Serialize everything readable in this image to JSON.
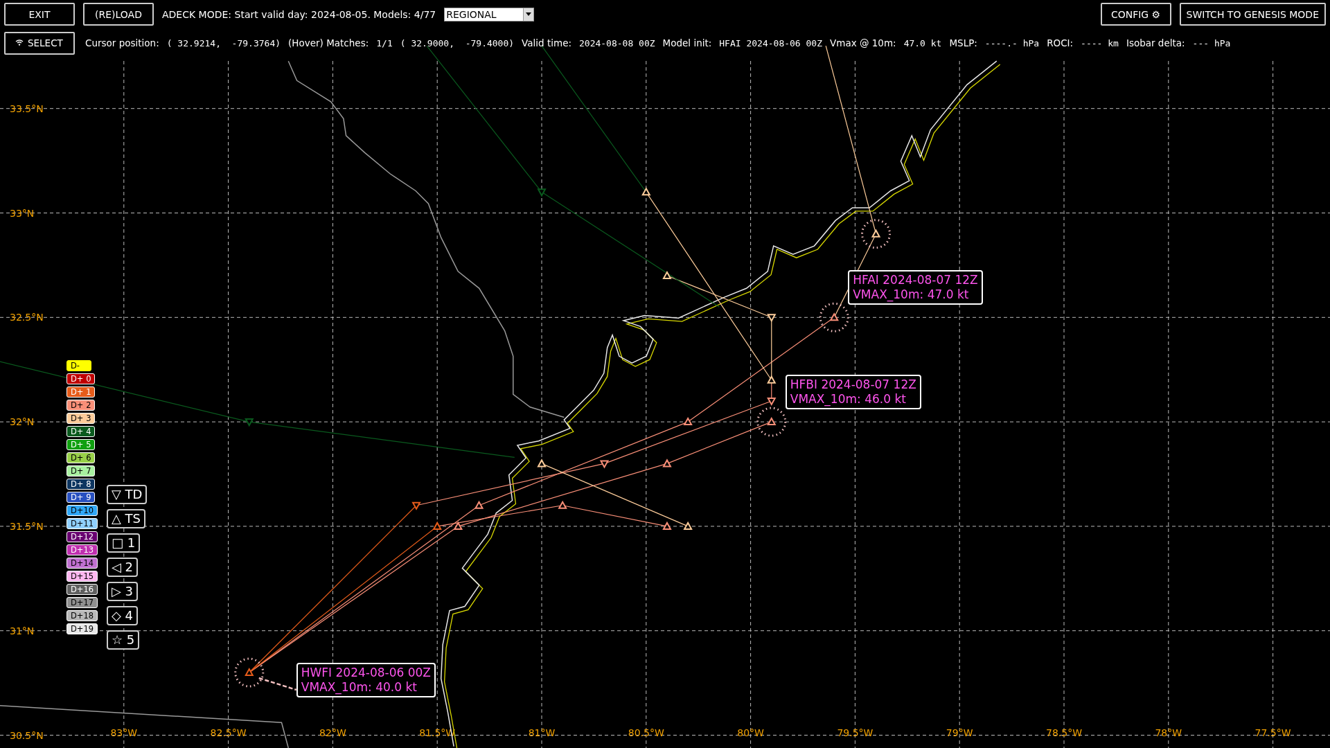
{
  "toolbar": {
    "left_buttons": [
      "EXIT",
      "(RE)LOAD"
    ],
    "mode_text": "ADECK MODE: Start valid day: 2024-08-05. Models: 4/77",
    "region_select": {
      "value": "REGIONAL"
    },
    "right_buttons": [
      "CONFIG ⚙",
      "SWITCH TO GENESIS MODE"
    ]
  },
  "status_bar": {
    "select_button": "SELECT",
    "fields": [
      {
        "label": "Cursor position:",
        "values": [
          "( 32.9214,  -79.3764)"
        ]
      },
      {
        "label": "(Hover) Matches:",
        "values": [
          "1/1",
          "( 32.9000,  -79.4000)"
        ]
      },
      {
        "label": "Valid time:",
        "values": [
          "2024-08-08 00Z"
        ]
      },
      {
        "label": "Model init:",
        "values": [
          "HFAI 2024-08-06 00Z"
        ]
      },
      {
        "label": "Vmax @ 10m:",
        "values": [
          "47.0 kt"
        ]
      },
      {
        "label": "MSLP:",
        "values": [
          "----.- hPa"
        ]
      },
      {
        "label": "ROCI:",
        "values": [
          "---- km"
        ]
      },
      {
        "label": "Isobar delta:",
        "values": [
          "--- hPa"
        ]
      }
    ]
  },
  "map": {
    "lat_labels": [
      "33.5°N",
      "33°N",
      "32.5°N",
      "32°N",
      "31.5°N",
      "31°N",
      "30.5°N"
    ],
    "lon_labels": [
      "83°W",
      "82.5°W",
      "82°W",
      "81.5°W",
      "81°W",
      "80.5°W",
      "80°W",
      "79.5°W",
      "79°W",
      "78.5°W",
      "78°W",
      "77.5°W"
    ],
    "hover_labels": [
      {
        "title": "HFAI 2024-08-07 12Z",
        "vmax": "VMAX_10m: 47.0 kt"
      },
      {
        "title": "HFBI 2024-08-07 12Z",
        "vmax": "VMAX_10m: 46.0 kt"
      },
      {
        "title": "HWFI 2024-08-06 00Z",
        "vmax": "VMAX_10m: 40.0 kt"
      }
    ]
  },
  "day_legend": [
    {
      "label": "D-",
      "color": "#ffff00"
    },
    {
      "label": "D+ 0",
      "color": "#c00000"
    },
    {
      "label": "D+ 1",
      "color": "#e65c1a"
    },
    {
      "label": "D+ 2",
      "color": "#fa8f78"
    },
    {
      "label": "D+ 3",
      "color": "#fdcc9a"
    },
    {
      "label": "D+ 4",
      "color": "#0a5a1e"
    },
    {
      "label": "D+ 5",
      "color": "#10a010"
    },
    {
      "label": "D+ 6",
      "color": "#98d048"
    },
    {
      "label": "D+ 7",
      "color": "#a8f0a0"
    },
    {
      "label": "D+ 8",
      "color": "#0d3560"
    },
    {
      "label": "D+ 9",
      "color": "#2850c0"
    },
    {
      "label": "D+10",
      "color": "#30a8f8"
    },
    {
      "label": "D+11",
      "color": "#90d0ff"
    },
    {
      "label": "D+12",
      "color": "#680070"
    },
    {
      "label": "D+13",
      "color": "#c030b0"
    },
    {
      "label": "D+14",
      "color": "#c070d0"
    },
    {
      "label": "D+15",
      "color": "#ffb8f0"
    },
    {
      "label": "D+16",
      "color": "#606060"
    },
    {
      "label": "D+17",
      "color": "#909090"
    },
    {
      "label": "D+18",
      "color": "#b8b8b8"
    },
    {
      "label": "D+19",
      "color": "#e8e8e8"
    }
  ],
  "symbol_legend": [
    "▽ TD",
    "△ TS",
    "□ 1",
    "◁ 2",
    "▷ 3",
    "◇ 4",
    "☆ 5"
  ]
}
